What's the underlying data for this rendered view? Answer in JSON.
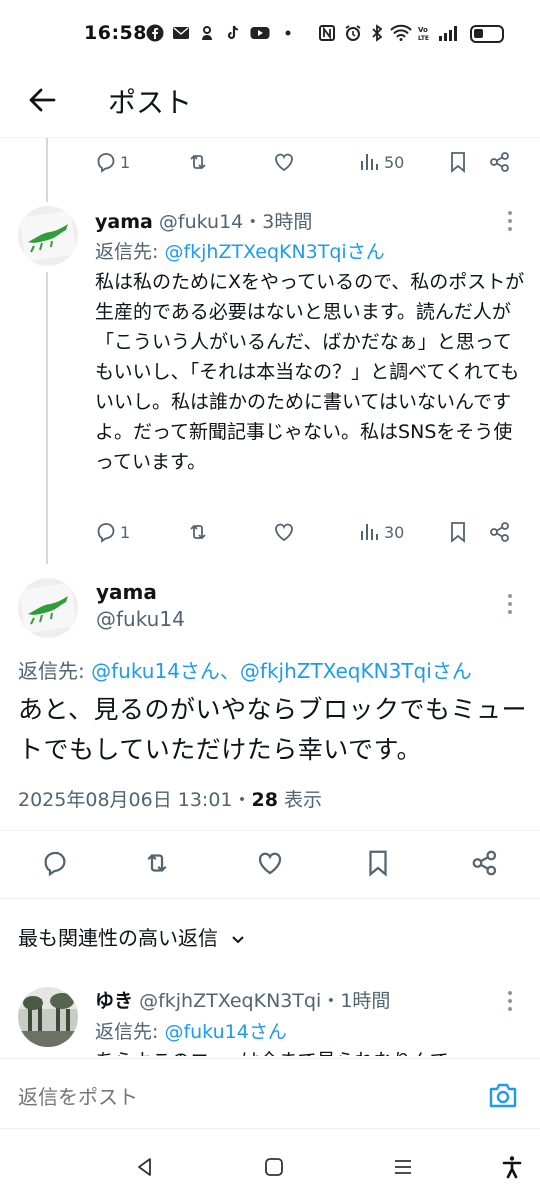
{
  "status_bar": {
    "time": "16:58",
    "left_icons": [
      "facebook-icon",
      "mail-icon",
      "app-icon",
      "tiktok-icon",
      "youtube-icon",
      "dot-icon"
    ],
    "right_icons": [
      "nfc-icon",
      "alarm-icon",
      "bluetooth-icon",
      "wifi-icon",
      "volte-icon",
      "signal-icon",
      "battery-icon"
    ]
  },
  "header": {
    "title": "ポスト",
    "back_icon": "back-arrow-icon"
  },
  "prev_tweet_actions": {
    "replies": "1",
    "views": "50"
  },
  "reply1": {
    "name": "yama",
    "handle": "@fuku14",
    "time": "・3時間",
    "reply_to_label": "返信先: ",
    "reply_to_handle": "@fkjhZTXeqKN3Tqiさん",
    "text": "私は私のためにXをやっているので、私のポストが生産的である必要はないと思います。読んだ人が「こういう人がいるんだ、ばかだなぁ」と思ってもいいし、「それは本当なの？」と調べてくれてもいいし。私は誰かのために書いてはいないんですよ。だって新聞記事じゃない。私はSNSをそう使っています。",
    "replies": "1",
    "views": "30"
  },
  "main_tweet": {
    "name": "yama",
    "handle": "@fuku14",
    "reply_to_label": "返信先: ",
    "reply_to_handles": "@fuku14さん、@fkjhZTXeqKN3Tqiさん",
    "text": "あと、見るのがいやならブロックでもミュートでもしていただけたら幸いです。",
    "timestamp": "2025年08月06日 13:01・",
    "views_count": "28",
    "views_label": " 表示"
  },
  "sort": {
    "label": "最も関連性の高い返信"
  },
  "reply2": {
    "name": "ゆき",
    "handle": "@fkjhZTXeqKN3Tqi",
    "time": "・1時間",
    "reply_to_label": "返信先: ",
    "reply_to_handle": "@fuku14さん",
    "partial_text": "あらよこのエー‥は全まで見られなりんで"
  },
  "compose": {
    "placeholder": "返信をポスト"
  },
  "colors": {
    "accent": "#1d9bf0",
    "text": "#0f1419",
    "muted": "#536471",
    "border": "#eff3f4"
  }
}
